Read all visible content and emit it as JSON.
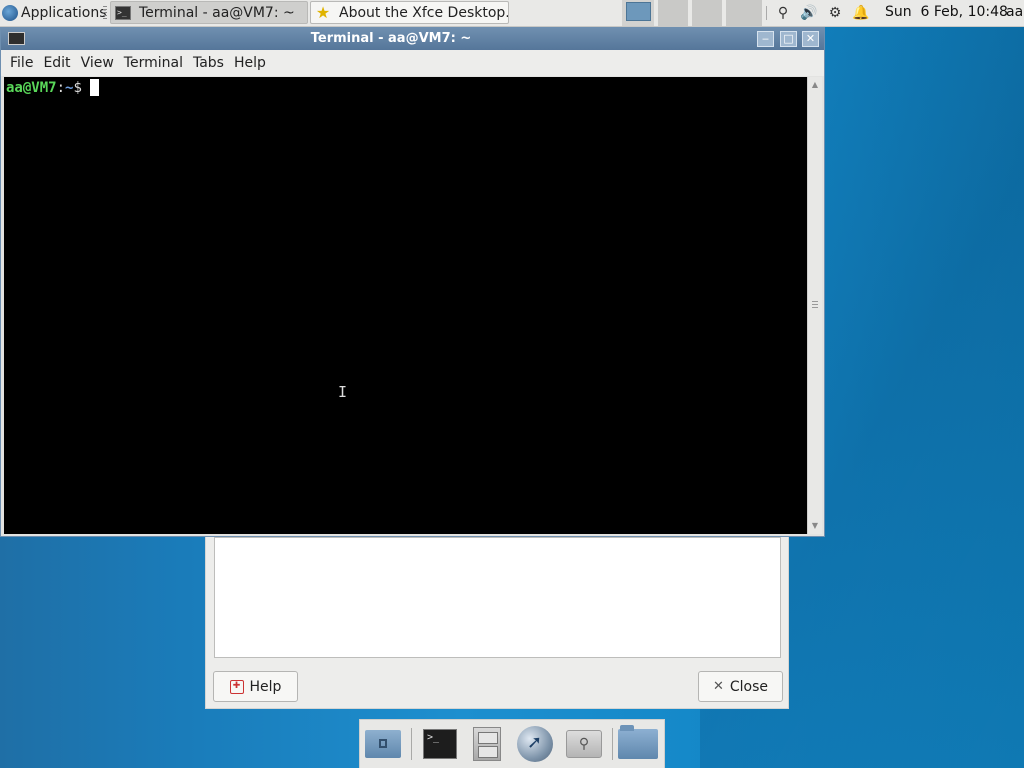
{
  "top_panel": {
    "apps_label": "Applications",
    "tasks": [
      {
        "label": "Terminal - aa@VM7: ~",
        "icon": "terminal-icon",
        "active": true
      },
      {
        "label": "About the Xfce Desktop...",
        "icon": "star-icon",
        "active": false
      }
    ],
    "workspace_count": 4,
    "active_workspace": 1,
    "tray_icons": [
      "search-tray-icon",
      "volume-icon",
      "network-icon",
      "notification-bell-icon"
    ],
    "clock": "Sun  6 Feb, 10:48",
    "user": "aa"
  },
  "terminal": {
    "title": "Terminal - aa@VM7: ~",
    "menu": [
      "File",
      "Edit",
      "View",
      "Terminal",
      "Tabs",
      "Help"
    ],
    "prompt_user": "aa@VM7",
    "prompt_colon": ":",
    "prompt_path": "~",
    "prompt_dollar": "$",
    "colors": {
      "user": "#59d759",
      "path": "#6f9fe0",
      "background": "#000000"
    }
  },
  "about_dialog": {
    "help_label": "Help",
    "close_label": "Close"
  },
  "dock": {
    "items": [
      "home-folder-icon",
      "terminal-icon",
      "file-cabinet-icon",
      "web-browser-icon",
      "app-finder-icon",
      "folder-icon"
    ]
  },
  "colors": {
    "desktop": "#1a7cba",
    "title_bar": "#6f8fb0",
    "panel": "#e9e9e7"
  }
}
